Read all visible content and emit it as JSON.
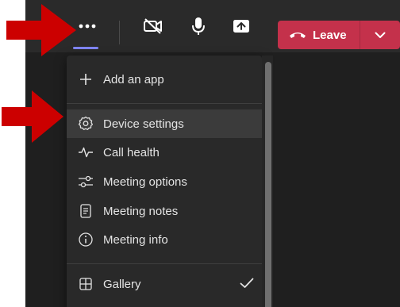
{
  "toolbar": {
    "more_icon": "more-dots-icon",
    "camera_icon": "camera-off-icon",
    "mic_icon": "microphone-icon",
    "share_icon": "share-screen-icon",
    "leave_label": "Leave",
    "leave_icon": "phone-hangup-icon",
    "leave_color": "#c4314b",
    "active_indicator_color": "#7f85f5"
  },
  "menu": {
    "items": [
      {
        "label": "Add an app",
        "icon": "plus-icon"
      },
      {
        "label": "Device settings",
        "icon": "gear-icon",
        "highlighted": true
      },
      {
        "label": "Call health",
        "icon": "pulse-icon"
      },
      {
        "label": "Meeting options",
        "icon": "sliders-icon"
      },
      {
        "label": "Meeting notes",
        "icon": "notes-icon"
      },
      {
        "label": "Meeting info",
        "icon": "info-icon"
      },
      {
        "label": "Gallery",
        "icon": "grid-icon",
        "checked": true
      }
    ]
  },
  "annotations": {
    "arrow_color": "#cc0000"
  }
}
